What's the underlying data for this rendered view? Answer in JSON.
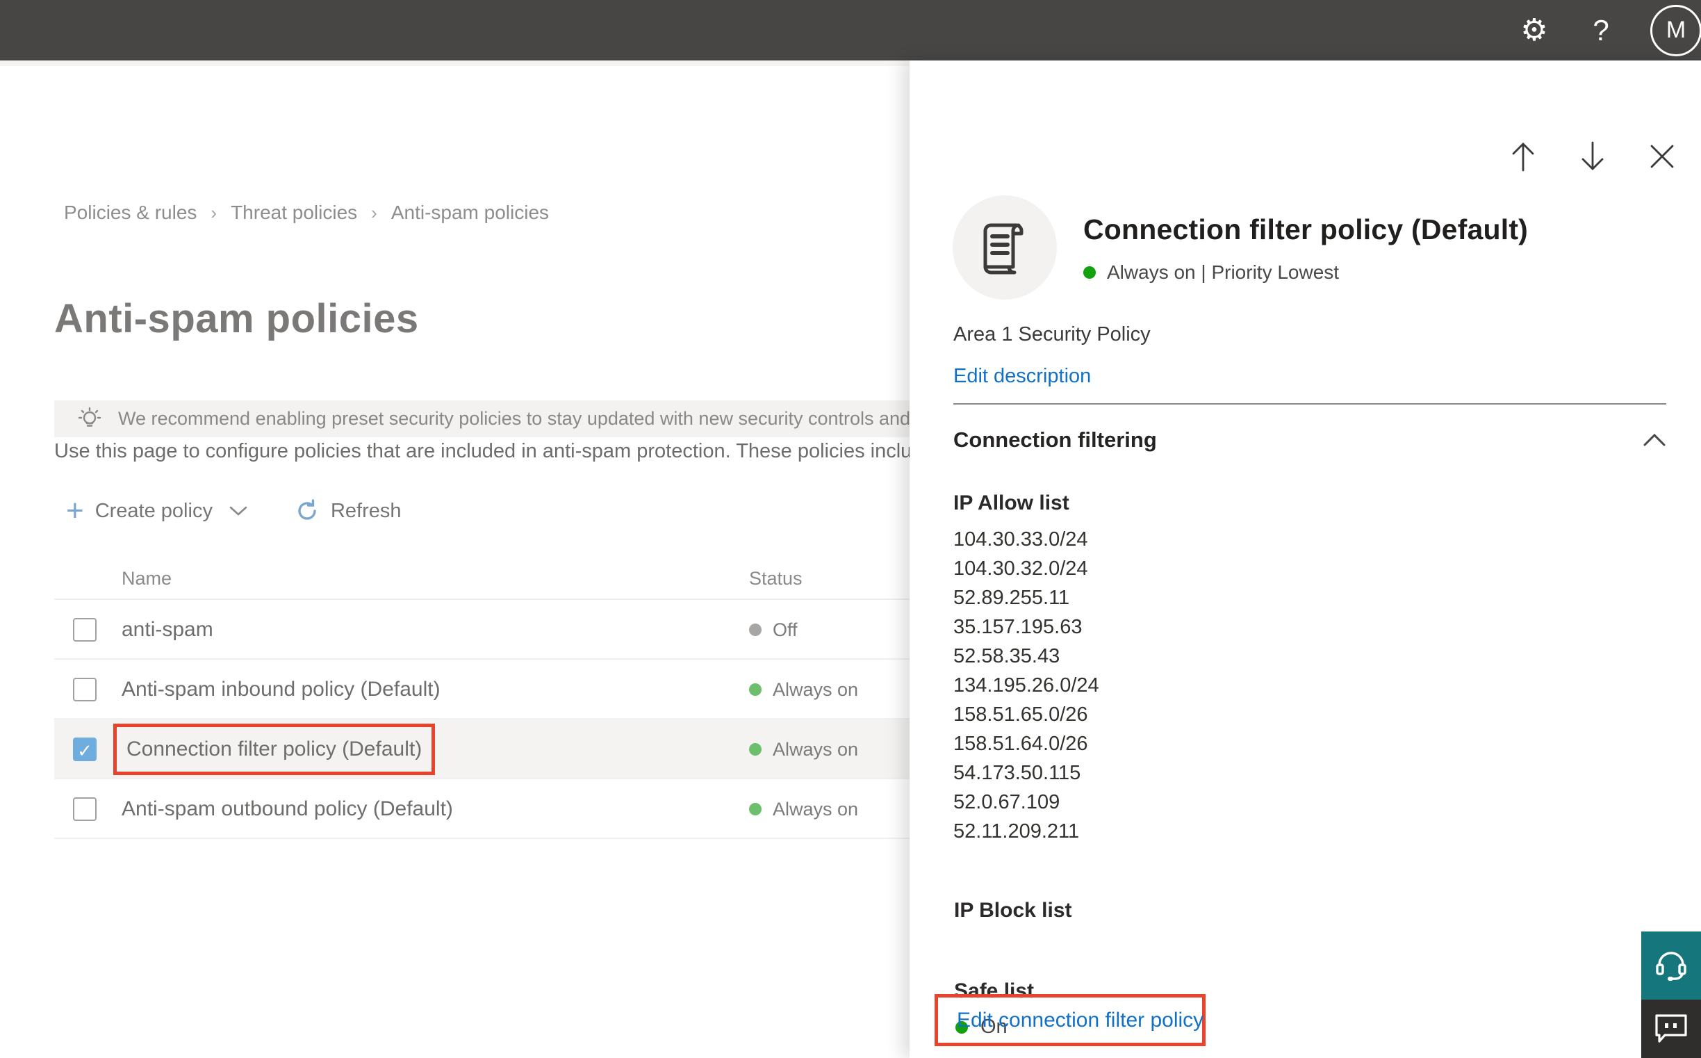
{
  "colors": {
    "accent_blue": "#1170c7",
    "highlight_red": "#e8432c",
    "green_on": "#13a10e",
    "green_on_dim": "#6cbf6c",
    "gray_off": "#a8a6a4",
    "teal_help": "#15767c",
    "topbar_bg": "#484644"
  },
  "topbar": {
    "gear_icon": "settings",
    "help_icon": "help",
    "avatar_initial": "M"
  },
  "breadcrumb": {
    "separator": "›",
    "items": [
      "Policies & rules",
      "Threat policies",
      "Anti-spam policies"
    ]
  },
  "page": {
    "title": "Anti-spam policies",
    "banner_text": "We recommend enabling preset security policies to stay updated with new security controls and our recomme",
    "description": "Use this page to configure policies that are included in anti-spam protection. These policies include"
  },
  "toolbar": {
    "create_policy_label": "Create policy",
    "refresh_label": "Refresh"
  },
  "table": {
    "columns": [
      "Name",
      "Status"
    ],
    "rows": [
      {
        "name": "anti-spam",
        "status": "Off",
        "status_kind": "off",
        "checked": false,
        "selected": false,
        "outlined": false
      },
      {
        "name": "Anti-spam inbound policy (Default)",
        "status": "Always on",
        "status_kind": "on",
        "checked": false,
        "selected": false,
        "outlined": false
      },
      {
        "name": "Connection filter policy (Default)",
        "status": "Always on",
        "status_kind": "on",
        "checked": true,
        "selected": true,
        "outlined": true
      },
      {
        "name": "Anti-spam outbound policy (Default)",
        "status": "Always on",
        "status_kind": "on",
        "checked": false,
        "selected": false,
        "outlined": false
      }
    ]
  },
  "panel": {
    "title": "Connection filter policy (Default)",
    "status_line": "Always on | Priority Lowest",
    "description": "Area 1 Security Policy",
    "edit_description_label": "Edit description",
    "section_title": "Connection filtering",
    "ip_allow_label": "IP Allow list",
    "ip_allow_list": [
      "104.30.33.0/24",
      "104.30.32.0/24",
      "52.89.255.11",
      "35.157.195.63",
      "52.58.35.43",
      "134.195.26.0/24",
      "158.51.65.0/26",
      "158.51.64.0/26",
      "54.173.50.115",
      "52.0.67.109",
      "52.11.209.211"
    ],
    "ip_block_label": "IP Block list",
    "safe_list_label": "Safe list",
    "safe_list_value": "On",
    "edit_link_label": "Edit connection filter policy"
  }
}
